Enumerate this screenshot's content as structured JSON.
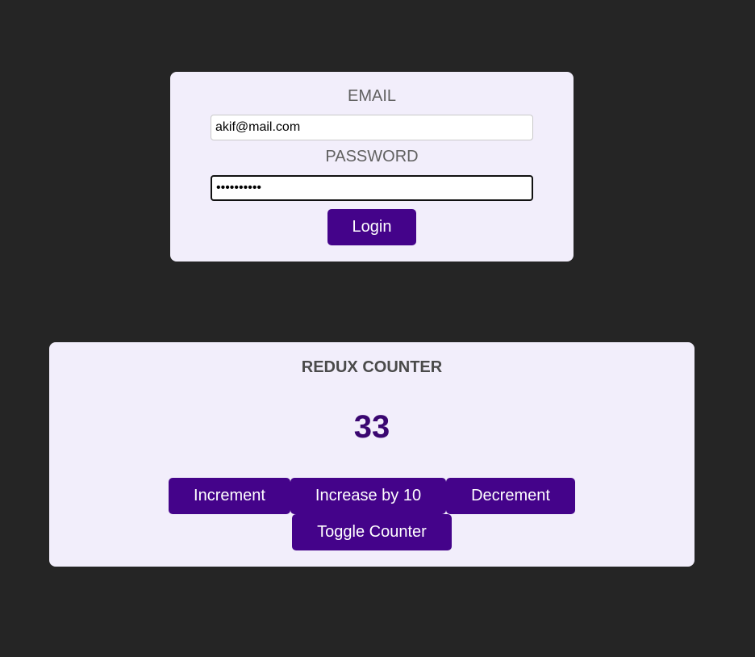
{
  "login": {
    "email_label": "EMAIL",
    "email_value": "akif@mail.com",
    "password_label": "PASSWORD",
    "password_value": "••••••••••",
    "login_button": "Login"
  },
  "counter": {
    "title": "REDUX COUNTER",
    "value": "33",
    "buttons": {
      "increment": "Increment",
      "increase_by_10": "Increase by 10",
      "decrement": "Decrement",
      "toggle": "Toggle Counter"
    }
  },
  "colors": {
    "background": "#252525",
    "card": "#f2eefb",
    "accent": "#44038a",
    "counter_value": "#3a0670"
  }
}
